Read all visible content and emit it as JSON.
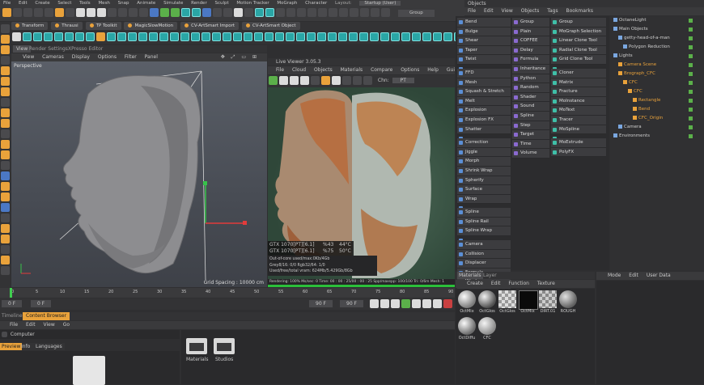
{
  "menubar": [
    "File",
    "Edit",
    "Create",
    "Select",
    "Tools",
    "Mesh",
    "Snap",
    "Animate",
    "Simulate",
    "Render",
    "Sculpt",
    "Motion Tracker",
    "MoGraph",
    "Character"
  ],
  "layout": {
    "label": "Layout:",
    "value": "Startup (User)"
  },
  "group_label": "Group",
  "plugin_tabs": [
    "Transform",
    "Thrausi",
    "TP Toolkit",
    "MagicSlowMotion",
    "CV-ArtSmart Import",
    "CV-ArtSmart Object"
  ],
  "viewport": {
    "tabs": [
      "View",
      "Render Settings",
      "XPresso Editor"
    ],
    "menu": [
      "View",
      "Cameras",
      "Display",
      "Options",
      "Filter",
      "Panel"
    ],
    "label": "Perspective",
    "grid_spacing": "Grid Spacing : 10000 cm"
  },
  "live_viewer": {
    "title": "Live Viewer 3.05.3",
    "menu": [
      "File",
      "Cloud",
      "Objects",
      "Materials",
      "Compare",
      "Options",
      "Help",
      "Gui"
    ],
    "chn_label": "Chn:",
    "chn_value": "PT",
    "stats": [
      {
        "gpu": "GTX 1070[PT][6.1]",
        "pct": "%43",
        "temp": "44°C"
      },
      {
        "gpu": "GTX 1070[PT][6.1]",
        "pct": "%75",
        "temp": "50°C"
      }
    ],
    "status_lines": [
      "Out-of-core used/max:0Kb/4Gb",
      "Grey8/16: 0/0        Rgb32/64: 1/0",
      "Used/free/total vram: 624Mb/5.429Gb/8Gb"
    ],
    "render_line": "Rendering: 100%  Ms/sec: 0   Time: 00 : 00 : 25/00 : 00 : 25   Spp/maxspp: 100/100   Tri: 0/6m   Mesh: 1"
  },
  "objects_panel": {
    "title": "Objects",
    "menu": [
      "File",
      "Edit",
      "View",
      "Objects",
      "Tags",
      "Bookmarks"
    ],
    "tree": [
      {
        "label": "OctaneLight",
        "color": "#cfcfcf"
      },
      {
        "label": "Main Objects",
        "color": "#cfcfcf"
      },
      {
        "label": "getty-head-of-a-man",
        "color": "#cfcfcf"
      },
      {
        "label": "Polygon Reduction",
        "color": "#cfcfcf"
      },
      {
        "label": "Lights",
        "color": "#cfcfcf"
      },
      {
        "label": "Camera Scene",
        "color": "#e9a23b"
      },
      {
        "label": "Brograph_CFC",
        "color": "#e9a23b"
      },
      {
        "label": "CFC",
        "color": "#e9a23b"
      },
      {
        "label": "CFC",
        "color": "#e9a23b"
      },
      {
        "label": "Rectangle",
        "color": "#e9a23b"
      },
      {
        "label": "Bend",
        "color": "#e9a23b"
      },
      {
        "label": "CFC_Origin",
        "color": "#e9a23b"
      },
      {
        "label": "Camera",
        "color": "#cfcfcf"
      },
      {
        "label": "Environments",
        "color": "#cfcfcf"
      }
    ]
  },
  "deformers_col1": [
    "Bend",
    "Bulge",
    "Shear",
    "Taper",
    "Twist",
    "",
    "FFD",
    "Mesh",
    "Squash & Stretch",
    "Melt",
    "Explosion",
    "Explosion FX",
    "Shatter",
    "",
    "Correction",
    "Jiggle",
    "Morph",
    "Shrink Wrap",
    "Spherify",
    "Surface",
    "Wrap",
    "",
    "Spline",
    "Spline Rail",
    "Spline Wrap",
    "",
    "Camera",
    "Collision",
    "Displacer",
    "Formula",
    "Wind",
    "Polygon Reduction",
    "Smoothing"
  ],
  "deformers_col2": [
    "Group",
    "Plain",
    "COFFEE",
    "Delay",
    "Formula",
    "Inheritance",
    "Python",
    "Random",
    "Shader",
    "Sound",
    "Spline",
    "Step",
    "Target",
    "Time",
    "Volume"
  ],
  "deformers_col3": [
    "Group",
    "MoGraph Selection",
    "Linear Clone Tool",
    "Radial Clone Tool",
    "Grid Clone Tool",
    "",
    "Cloner",
    "Matrix",
    "Fracture",
    "MoInstance",
    "MoText",
    "Tracer",
    "MoSpline",
    "",
    "MoExtrude",
    "PolyFX"
  ],
  "timeline": {
    "ticks": [
      "0",
      "5",
      "10",
      "15",
      "20",
      "25",
      "30",
      "35",
      "40",
      "45",
      "50",
      "55",
      "60",
      "65",
      "70",
      "75",
      "80",
      "85",
      "90"
    ],
    "frame_start": "0 F",
    "frame_a": "0 F",
    "frame_b": "90 F",
    "frame_c": "90 F"
  },
  "content_browser": {
    "tabs": [
      "Timeline",
      "Content Browser"
    ],
    "menu": [
      "File",
      "Edit",
      "View",
      "Go"
    ],
    "path": "Computer",
    "side_tabs": [
      "Preview",
      "Info",
      "Languages"
    ],
    "folders": [
      "Materials",
      "Studios"
    ]
  },
  "materials": {
    "tabs": [
      "Materials",
      "Layer"
    ],
    "menu": [
      "Create",
      "Edit",
      "Function",
      "Texture"
    ],
    "items": [
      "OctMix",
      "OctGlos",
      "OctGlos",
      "OctMix",
      "DIRT.01",
      "ROUGH",
      "OctDiffu",
      "CFC"
    ]
  },
  "attributes": {
    "menu": [
      "Mode",
      "Edit",
      "User Data"
    ]
  }
}
